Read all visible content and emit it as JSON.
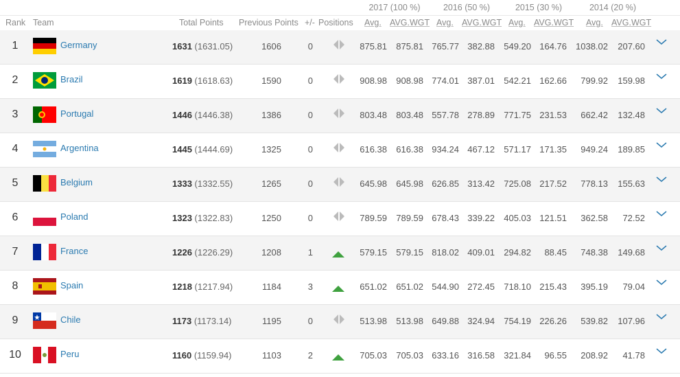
{
  "years": [
    {
      "label": "2017 (100 %)"
    },
    {
      "label": "2016 (50 %)"
    },
    {
      "label": "2015 (30 %)"
    },
    {
      "label": "2014 (20 %)"
    }
  ],
  "columns": {
    "rank": "Rank",
    "team": "Team",
    "total_points": "Total Points",
    "previous_points": "Previous Points",
    "change": "+/-",
    "positions": "Positions",
    "avg": "Avg.",
    "avg_wgt": "AVG.WGT"
  },
  "rows": [
    {
      "rank": "1",
      "team": "Germany",
      "flag": "germany",
      "total_bold": "1631",
      "total_exact": "(1631.05)",
      "prev": "1606",
      "change": "0",
      "trend": "same",
      "a17": "875.81",
      "w17": "875.81",
      "a16": "765.77",
      "w16": "382.88",
      "a15": "549.20",
      "w15": "164.76",
      "a14": "1038.02",
      "w14": "207.60"
    },
    {
      "rank": "2",
      "team": "Brazil",
      "flag": "brazil",
      "total_bold": "1619",
      "total_exact": "(1618.63)",
      "prev": "1590",
      "change": "0",
      "trend": "same",
      "a17": "908.98",
      "w17": "908.98",
      "a16": "774.01",
      "w16": "387.01",
      "a15": "542.21",
      "w15": "162.66",
      "a14": "799.92",
      "w14": "159.98"
    },
    {
      "rank": "3",
      "team": "Portugal",
      "flag": "portugal",
      "total_bold": "1446",
      "total_exact": "(1446.38)",
      "prev": "1386",
      "change": "0",
      "trend": "same",
      "a17": "803.48",
      "w17": "803.48",
      "a16": "557.78",
      "w16": "278.89",
      "a15": "771.75",
      "w15": "231.53",
      "a14": "662.42",
      "w14": "132.48"
    },
    {
      "rank": "4",
      "team": "Argentina",
      "flag": "argentina",
      "total_bold": "1445",
      "total_exact": "(1444.69)",
      "prev": "1325",
      "change": "0",
      "trend": "same",
      "a17": "616.38",
      "w17": "616.38",
      "a16": "934.24",
      "w16": "467.12",
      "a15": "571.17",
      "w15": "171.35",
      "a14": "949.24",
      "w14": "189.85"
    },
    {
      "rank": "5",
      "team": "Belgium",
      "flag": "belgium",
      "total_bold": "1333",
      "total_exact": "(1332.55)",
      "prev": "1265",
      "change": "0",
      "trend": "same",
      "a17": "645.98",
      "w17": "645.98",
      "a16": "626.85",
      "w16": "313.42",
      "a15": "725.08",
      "w15": "217.52",
      "a14": "778.13",
      "w14": "155.63"
    },
    {
      "rank": "6",
      "team": "Poland",
      "flag": "poland",
      "total_bold": "1323",
      "total_exact": "(1322.83)",
      "prev": "1250",
      "change": "0",
      "trend": "same",
      "a17": "789.59",
      "w17": "789.59",
      "a16": "678.43",
      "w16": "339.22",
      "a15": "405.03",
      "w15": "121.51",
      "a14": "362.58",
      "w14": "72.52"
    },
    {
      "rank": "7",
      "team": "France",
      "flag": "france",
      "total_bold": "1226",
      "total_exact": "(1226.29)",
      "prev": "1208",
      "change": "1",
      "trend": "up",
      "a17": "579.15",
      "w17": "579.15",
      "a16": "818.02",
      "w16": "409.01",
      "a15": "294.82",
      "w15": "88.45",
      "a14": "748.38",
      "w14": "149.68"
    },
    {
      "rank": "8",
      "team": "Spain",
      "flag": "spain",
      "total_bold": "1218",
      "total_exact": "(1217.94)",
      "prev": "1184",
      "change": "3",
      "trend": "up",
      "a17": "651.02",
      "w17": "651.02",
      "a16": "544.90",
      "w16": "272.45",
      "a15": "718.10",
      "w15": "215.43",
      "a14": "395.19",
      "w14": "79.04"
    },
    {
      "rank": "9",
      "team": "Chile",
      "flag": "chile",
      "total_bold": "1173",
      "total_exact": "(1173.14)",
      "prev": "1195",
      "change": "0",
      "trend": "same",
      "a17": "513.98",
      "w17": "513.98",
      "a16": "649.88",
      "w16": "324.94",
      "a15": "754.19",
      "w15": "226.26",
      "a14": "539.82",
      "w14": "107.96"
    },
    {
      "rank": "10",
      "team": "Peru",
      "flag": "peru",
      "total_bold": "1160",
      "total_exact": "(1159.94)",
      "prev": "1103",
      "change": "2",
      "trend": "up",
      "a17": "705.03",
      "w17": "705.03",
      "a16": "633.16",
      "w16": "316.58",
      "a15": "321.84",
      "w15": "96.55",
      "a14": "208.92",
      "w14": "41.78"
    }
  ],
  "colors": {
    "link": "#2a7ab0",
    "up": "#3fa13f",
    "chevron": "#2a7ab0"
  }
}
